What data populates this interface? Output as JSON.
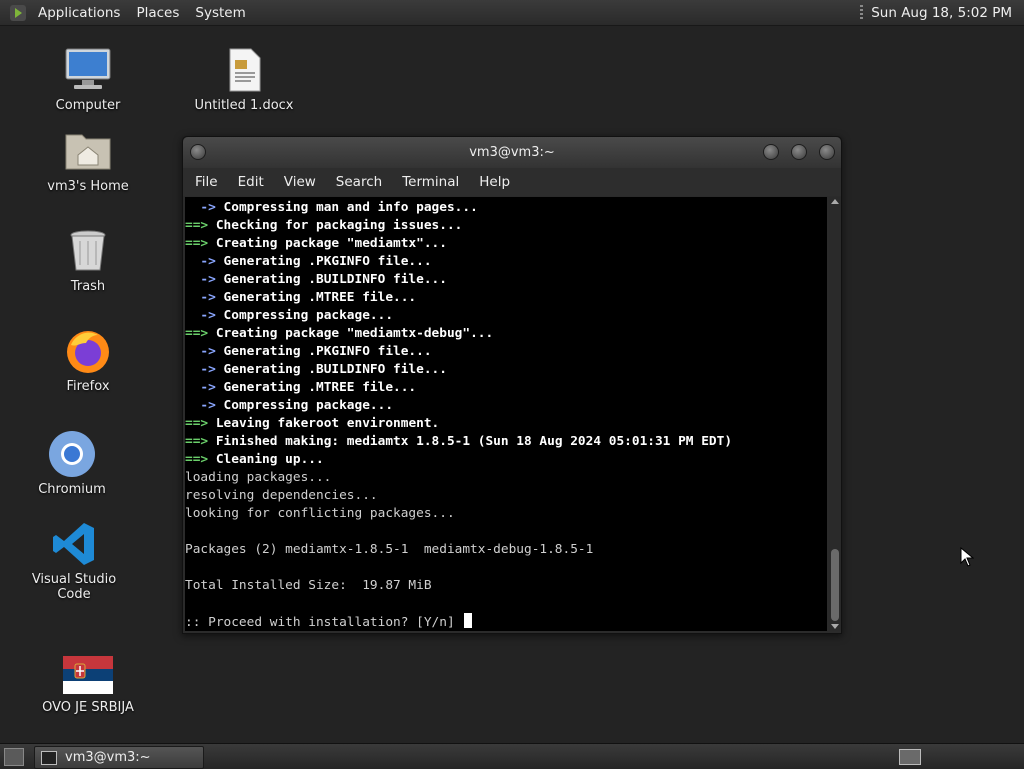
{
  "top_panel": {
    "menus": [
      "Applications",
      "Places",
      "System"
    ],
    "clock": "Sun Aug 18,  5:02 PM"
  },
  "desktop_icons": [
    {
      "label": "Computer",
      "icon": "computer-icon"
    },
    {
      "label": "Untitled 1.docx",
      "icon": "document-icon"
    },
    {
      "label": "vm3's Home",
      "icon": "home-folder-icon"
    },
    {
      "label": "Trash",
      "icon": "trash-icon"
    },
    {
      "label": "Firefox",
      "icon": "firefox-icon"
    },
    {
      "label": "Chromium",
      "icon": "chromium-icon"
    },
    {
      "label": "Visual Studio Code",
      "icon": "vscode-icon"
    },
    {
      "label": "OVO JE SRBIJA",
      "icon": "serbia-flag-icon"
    }
  ],
  "terminal": {
    "title": "vm3@vm3:~",
    "menu": [
      "File",
      "Edit",
      "View",
      "Search",
      "Terminal",
      "Help"
    ],
    "lines": [
      {
        "prefix": "  -> ",
        "text": "Compressing man and info pages...",
        "kind": "sub"
      },
      {
        "prefix": "==> ",
        "text": "Checking for packaging issues...",
        "kind": "main"
      },
      {
        "prefix": "==> ",
        "text": "Creating package \"mediamtx\"...",
        "kind": "main"
      },
      {
        "prefix": "  -> ",
        "text": "Generating .PKGINFO file...",
        "kind": "sub"
      },
      {
        "prefix": "  -> ",
        "text": "Generating .BUILDINFO file...",
        "kind": "sub"
      },
      {
        "prefix": "  -> ",
        "text": "Generating .MTREE file...",
        "kind": "sub"
      },
      {
        "prefix": "  -> ",
        "text": "Compressing package...",
        "kind": "sub"
      },
      {
        "prefix": "==> ",
        "text": "Creating package \"mediamtx-debug\"...",
        "kind": "main"
      },
      {
        "prefix": "  -> ",
        "text": "Generating .PKGINFO file...",
        "kind": "sub"
      },
      {
        "prefix": "  -> ",
        "text": "Generating .BUILDINFO file...",
        "kind": "sub"
      },
      {
        "prefix": "  -> ",
        "text": "Generating .MTREE file...",
        "kind": "sub"
      },
      {
        "prefix": "  -> ",
        "text": "Compressing package...",
        "kind": "sub"
      },
      {
        "prefix": "==> ",
        "text": "Leaving fakeroot environment.",
        "kind": "main"
      },
      {
        "prefix": "==> ",
        "text": "Finished making: mediamtx 1.8.5-1 (Sun 18 Aug 2024 05:01:31 PM EDT)",
        "kind": "main"
      },
      {
        "prefix": "==> ",
        "text": "Cleaning up...",
        "kind": "main"
      },
      {
        "prefix": "",
        "text": "loading packages...",
        "kind": "plain"
      },
      {
        "prefix": "",
        "text": "resolving dependencies...",
        "kind": "plain"
      },
      {
        "prefix": "",
        "text": "looking for conflicting packages...",
        "kind": "plain"
      },
      {
        "prefix": "",
        "text": "",
        "kind": "plain"
      },
      {
        "prefix": "",
        "text": "Packages (2) mediamtx-1.8.5-1  mediamtx-debug-1.8.5-1",
        "kind": "plain"
      },
      {
        "prefix": "",
        "text": "",
        "kind": "plain"
      },
      {
        "prefix": "",
        "text": "Total Installed Size:  19.87 MiB",
        "kind": "plain"
      },
      {
        "prefix": "",
        "text": "",
        "kind": "plain"
      },
      {
        "prefix": "",
        "text": ":: Proceed with installation? [Y/n] ",
        "kind": "prompt"
      }
    ]
  },
  "taskbar": {
    "task_label": "vm3@vm3:~"
  },
  "colors": {
    "arrow_main": "#6bd06b",
    "arrow_sub": "#8aa6ff",
    "desktop_bg": "#232323"
  }
}
